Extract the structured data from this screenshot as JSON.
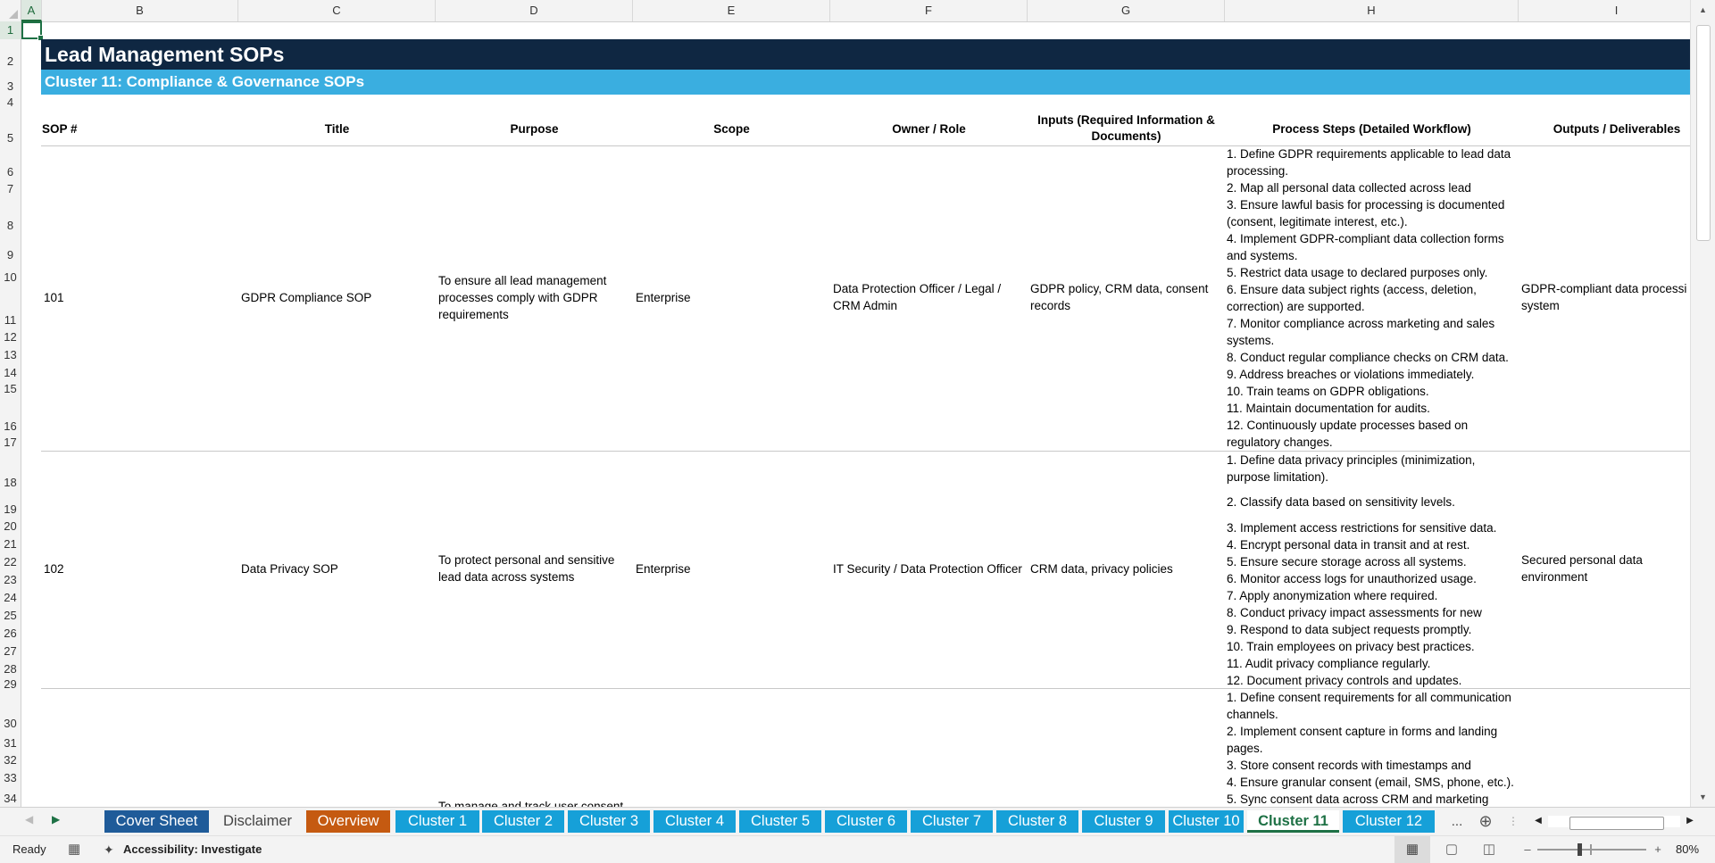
{
  "columns": [
    "A",
    "B",
    "C",
    "D",
    "E",
    "F",
    "G",
    "H",
    "I"
  ],
  "rows": [
    "1",
    "2",
    "3",
    "4",
    "5",
    "6",
    "7",
    "8",
    "9",
    "10",
    "11",
    "12",
    "13",
    "14",
    "15",
    "16",
    "17",
    "18",
    "19",
    "20",
    "21",
    "22",
    "23",
    "24",
    "25",
    "26",
    "27",
    "28",
    "29",
    "30",
    "31",
    "32",
    "33",
    "34"
  ],
  "sheet": {
    "title": "Lead Management SOPs",
    "subtitle": "Cluster 11: Compliance & Governance SOPs",
    "headers": {
      "sop": "SOP #",
      "title": "Title",
      "purpose": "Purpose",
      "scope": "Scope",
      "owner": "Owner / Role",
      "inputs": "Inputs (Required Information & Documents)",
      "steps": "Process Steps (Detailed Workflow)",
      "outputs": "Outputs / Deliverables"
    },
    "records": [
      {
        "sop": "101",
        "title": "GDPR Compliance SOP",
        "purpose": "To ensure all lead management processes comply with GDPR requirements",
        "scope": "Enterprise",
        "owner": "Data Protection Officer / Legal / CRM Admin",
        "inputs": "GDPR policy, CRM data, consent records",
        "outputs": "GDPR-compliant data processi system",
        "steps": [
          "1. Define GDPR requirements applicable to lead data processing.",
          "2. Map all personal data collected across lead",
          "3. Ensure lawful basis for processing is documented (consent, legitimate interest, etc.).",
          "4. Implement GDPR-compliant data collection forms and systems.",
          "5. Restrict data usage to declared purposes only.",
          "6. Ensure data subject rights (access, deletion, correction) are supported.",
          "7. Monitor compliance across marketing and sales systems.",
          "8. Conduct regular compliance checks on CRM data.",
          "9. Address breaches or violations immediately.",
          "10. Train teams on GDPR obligations.",
          "11. Maintain documentation for audits.",
          "12. Continuously update processes based on regulatory changes."
        ]
      },
      {
        "sop": "102",
        "title": "Data Privacy SOP",
        "purpose": "To protect personal and sensitive lead data across systems",
        "scope": "Enterprise",
        "owner": "IT Security / Data Protection Officer",
        "inputs": "CRM data, privacy policies",
        "outputs": "Secured personal data environment",
        "steps": [
          "1. Define data privacy principles (minimization, purpose limitation).",
          "2. Classify data based on sensitivity levels.",
          "3. Implement access restrictions for sensitive data.",
          "4. Encrypt personal data in transit and at rest.",
          "5. Ensure secure storage across all systems.",
          "6. Monitor access logs for unauthorized usage.",
          "7. Apply anonymization where required.",
          "8. Conduct privacy impact assessments for new",
          "9. Respond to data subject requests promptly.",
          "10. Train employees on privacy best practices.",
          "11. Audit privacy compliance regularly.",
          "12. Document privacy controls and updates."
        ]
      },
      {
        "purpose": "To manage and track user consent",
        "steps": [
          "1. Define consent requirements for all communication channels.",
          "2. Implement consent capture in forms and landing pages.",
          "3. Store consent records with timestamps and",
          "4. Ensure granular consent (email, SMS, phone, etc.).",
          "5. Sync consent data across CRM and marketing"
        ]
      }
    ]
  },
  "tabs": [
    {
      "label": "Cover Sheet",
      "style": "dark"
    },
    {
      "label": "Disclaimer",
      "style": "plain"
    },
    {
      "label": "Overview",
      "style": "orange"
    },
    {
      "label": "Cluster 1",
      "style": "cyan"
    },
    {
      "label": "Cluster 2",
      "style": "cyan"
    },
    {
      "label": "Cluster 3",
      "style": "cyan"
    },
    {
      "label": "Cluster 4",
      "style": "cyan"
    },
    {
      "label": "Cluster 5",
      "style": "cyan"
    },
    {
      "label": "Cluster 6",
      "style": "cyan"
    },
    {
      "label": "Cluster 7",
      "style": "cyan"
    },
    {
      "label": "Cluster 8",
      "style": "cyan"
    },
    {
      "label": "Cluster 9",
      "style": "cyan"
    },
    {
      "label": "Cluster 10",
      "style": "cyan"
    },
    {
      "label": "Cluster 11",
      "style": "active"
    },
    {
      "label": "Cluster 12",
      "style": "cyan"
    }
  ],
  "tab_overflow": "...",
  "status": {
    "ready": "Ready",
    "accessibility": "Accessibility: Investigate",
    "zoom": "80%"
  },
  "colors": {
    "title_band": "#0f2742",
    "subtitle_band": "#3aaee0",
    "tab_cyan": "#16a0d8",
    "tab_orange": "#c55a11",
    "tab_dark": "#1f5b99",
    "excel_green": "#1e7145"
  },
  "icons": [
    "sheet-nav-prev-icon",
    "sheet-nav-next-icon",
    "add-sheet-icon",
    "macro-record-icon",
    "accessibility-icon",
    "normal-view-icon",
    "page-layout-icon",
    "page-break-icon",
    "zoom-out-icon",
    "zoom-in-icon"
  ]
}
